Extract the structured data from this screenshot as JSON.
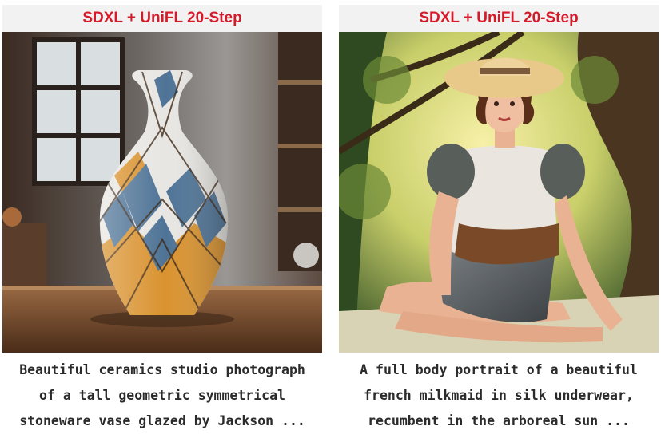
{
  "panels": [
    {
      "title": "SDXL + UniFL 20-Step",
      "caption_lines": [
        "Beautiful ceramics studio photograph",
        "of a tall geometric symmetrical",
        "stoneware vase glazed by Jackson ..."
      ]
    },
    {
      "title": "SDXL + UniFL 20-Step",
      "caption_lines": [
        "A full body portrait of a beautiful",
        "french milkmaid in silk underwear,",
        "recumbent in the arboreal sun ..."
      ]
    }
  ],
  "colors": {
    "title": "#d51a2a",
    "header_bg": "#f2f2f2",
    "caption": "#2b2b2b"
  }
}
